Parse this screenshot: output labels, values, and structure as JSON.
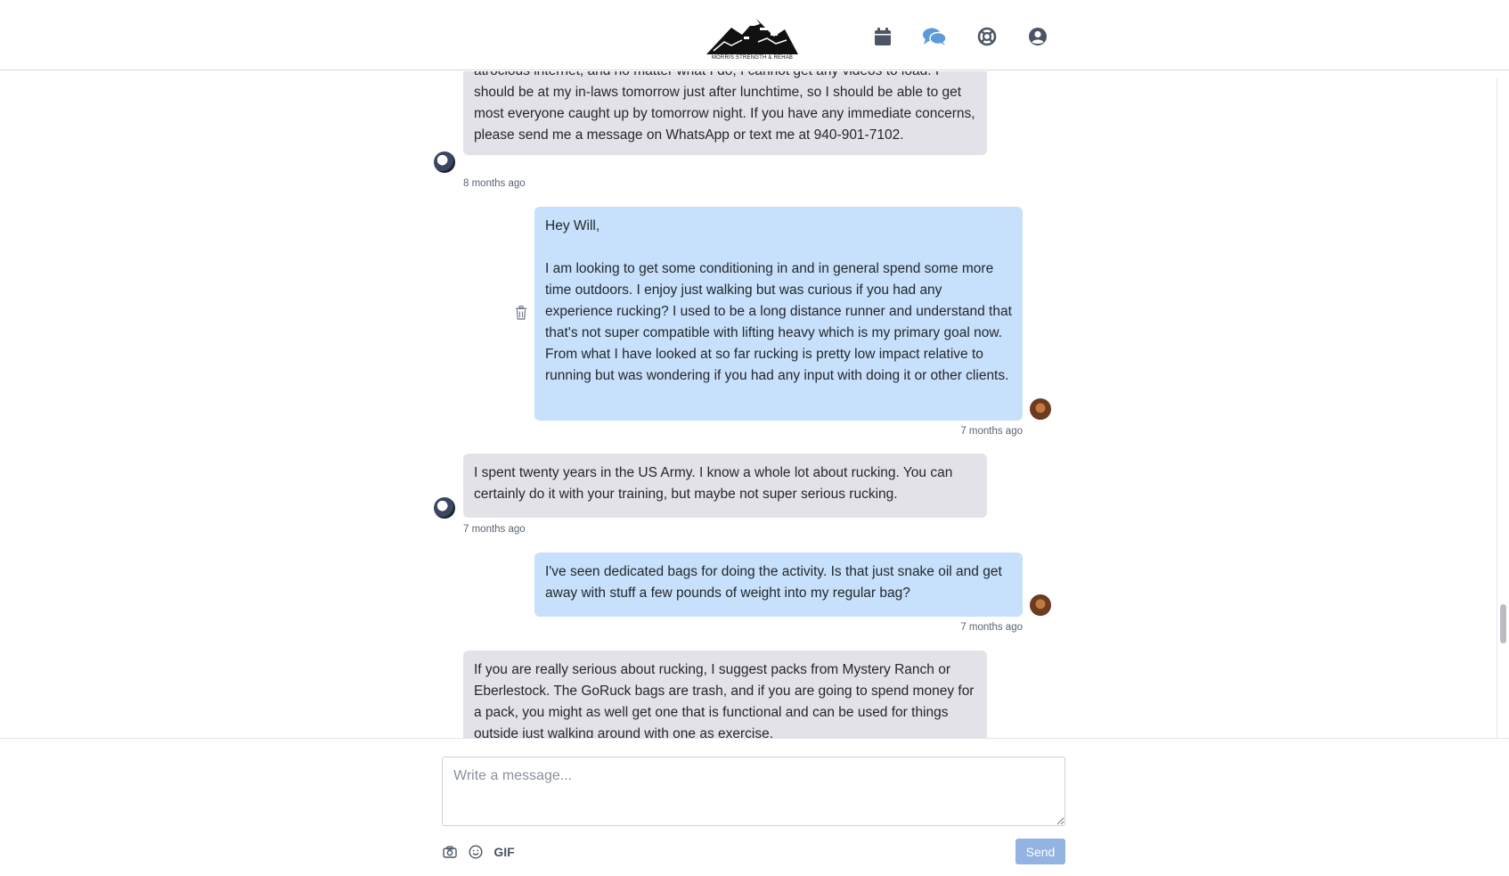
{
  "brand": {
    "logo_caption": "MORRIS STRENGTH & REHAB"
  },
  "nav": {
    "icons": [
      "calendar-icon",
      "chat-bubbles-icon",
      "support-lifebuoy-icon",
      "user-account-icon"
    ],
    "active_color": "#5a9bd8",
    "inactive_color": "#4b5563"
  },
  "messages": [
    {
      "side": "in",
      "text": "atrocious internet, and no matter what I do, I cannot get any videos to load. I should be at my in-laws tomorrow just after lunchtime, so I should be able to get most everyone caught up by tomorrow night. If you have any immediate concerns, please send me a message on WhatsApp or text me at 940-901-7102.",
      "time": "8 months ago"
    },
    {
      "side": "out",
      "text": "Hey Will,\n\nI am looking to get some conditioning in and in general spend some more time outdoors. I enjoy just walking but was curious if you had any experience rucking? I used to be a long distance runner and understand that that's not super compatible with lifting heavy which is my primary goal now. From what I have looked at so far rucking is pretty low impact relative to running but was wondering if you had any input with doing it or other clients.",
      "time": "7 months ago"
    },
    {
      "side": "in",
      "text": "I spent twenty years in the US Army. I know a whole lot about rucking. You can certainly do it with your training, but maybe not super serious rucking.",
      "time": "7 months ago"
    },
    {
      "side": "out",
      "text": "I've seen dedicated bags for doing the activity. Is that just snake oil and get away with stuff a few pounds of weight into my regular bag?",
      "time": "7 months ago"
    },
    {
      "side": "in",
      "text": "If you are really serious about rucking, I suggest packs from Mystery Ranch or Eberlestock. The GoRuck bags are trash, and if you are going to spend money for a pack, you might as well get one that is functional and can be used for things outside just walking around with one as exercise."
    }
  ],
  "composer": {
    "placeholder": "Write a message...",
    "gif_label": "GIF",
    "send_label": "Send",
    "send_color": "#93b3e3"
  },
  "colors": {
    "incoming_bubble": "#e3e2e8",
    "outgoing_bubble": "#c7e0fb"
  }
}
